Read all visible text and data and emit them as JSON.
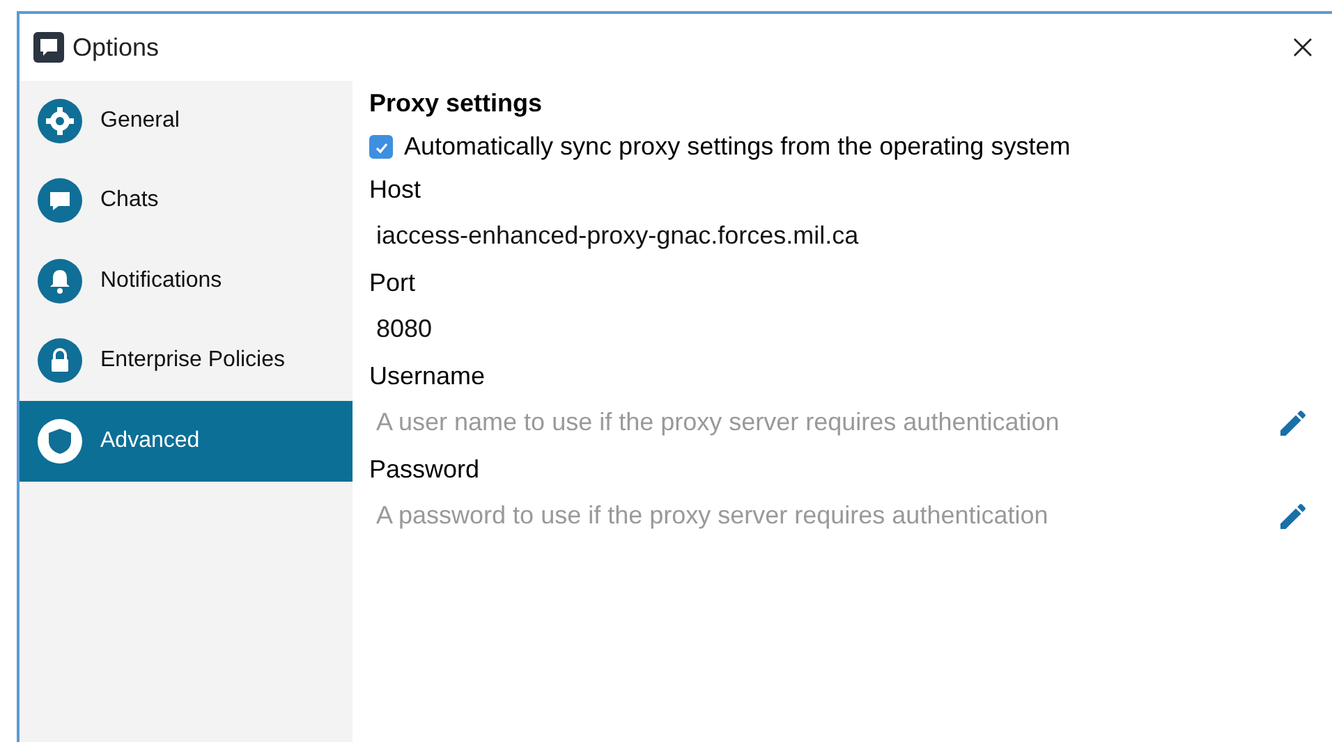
{
  "window": {
    "title": "Options"
  },
  "sidebar": {
    "items": [
      {
        "label": "General",
        "selected": false
      },
      {
        "label": "Chats",
        "selected": false
      },
      {
        "label": "Notifications",
        "selected": false
      },
      {
        "label": "Enterprise Policies",
        "selected": false
      },
      {
        "label": "Advanced",
        "selected": true
      }
    ]
  },
  "proxy": {
    "title": "Proxy settings",
    "sync": {
      "label": "Automatically sync proxy settings from the operating system",
      "checked": true
    },
    "fields": [
      {
        "label": "Host",
        "value": "iaccess-enhanced-proxy-gnac.forces.mil.ca",
        "editable": false
      },
      {
        "label": "Port",
        "value": "8080",
        "editable": false
      },
      {
        "label": "Username",
        "placeholder": "A user name to use if the proxy server requires authentication",
        "editable": true
      },
      {
        "label": "Password",
        "placeholder": "A password to use if the proxy server requires authentication",
        "editable": true
      }
    ]
  }
}
